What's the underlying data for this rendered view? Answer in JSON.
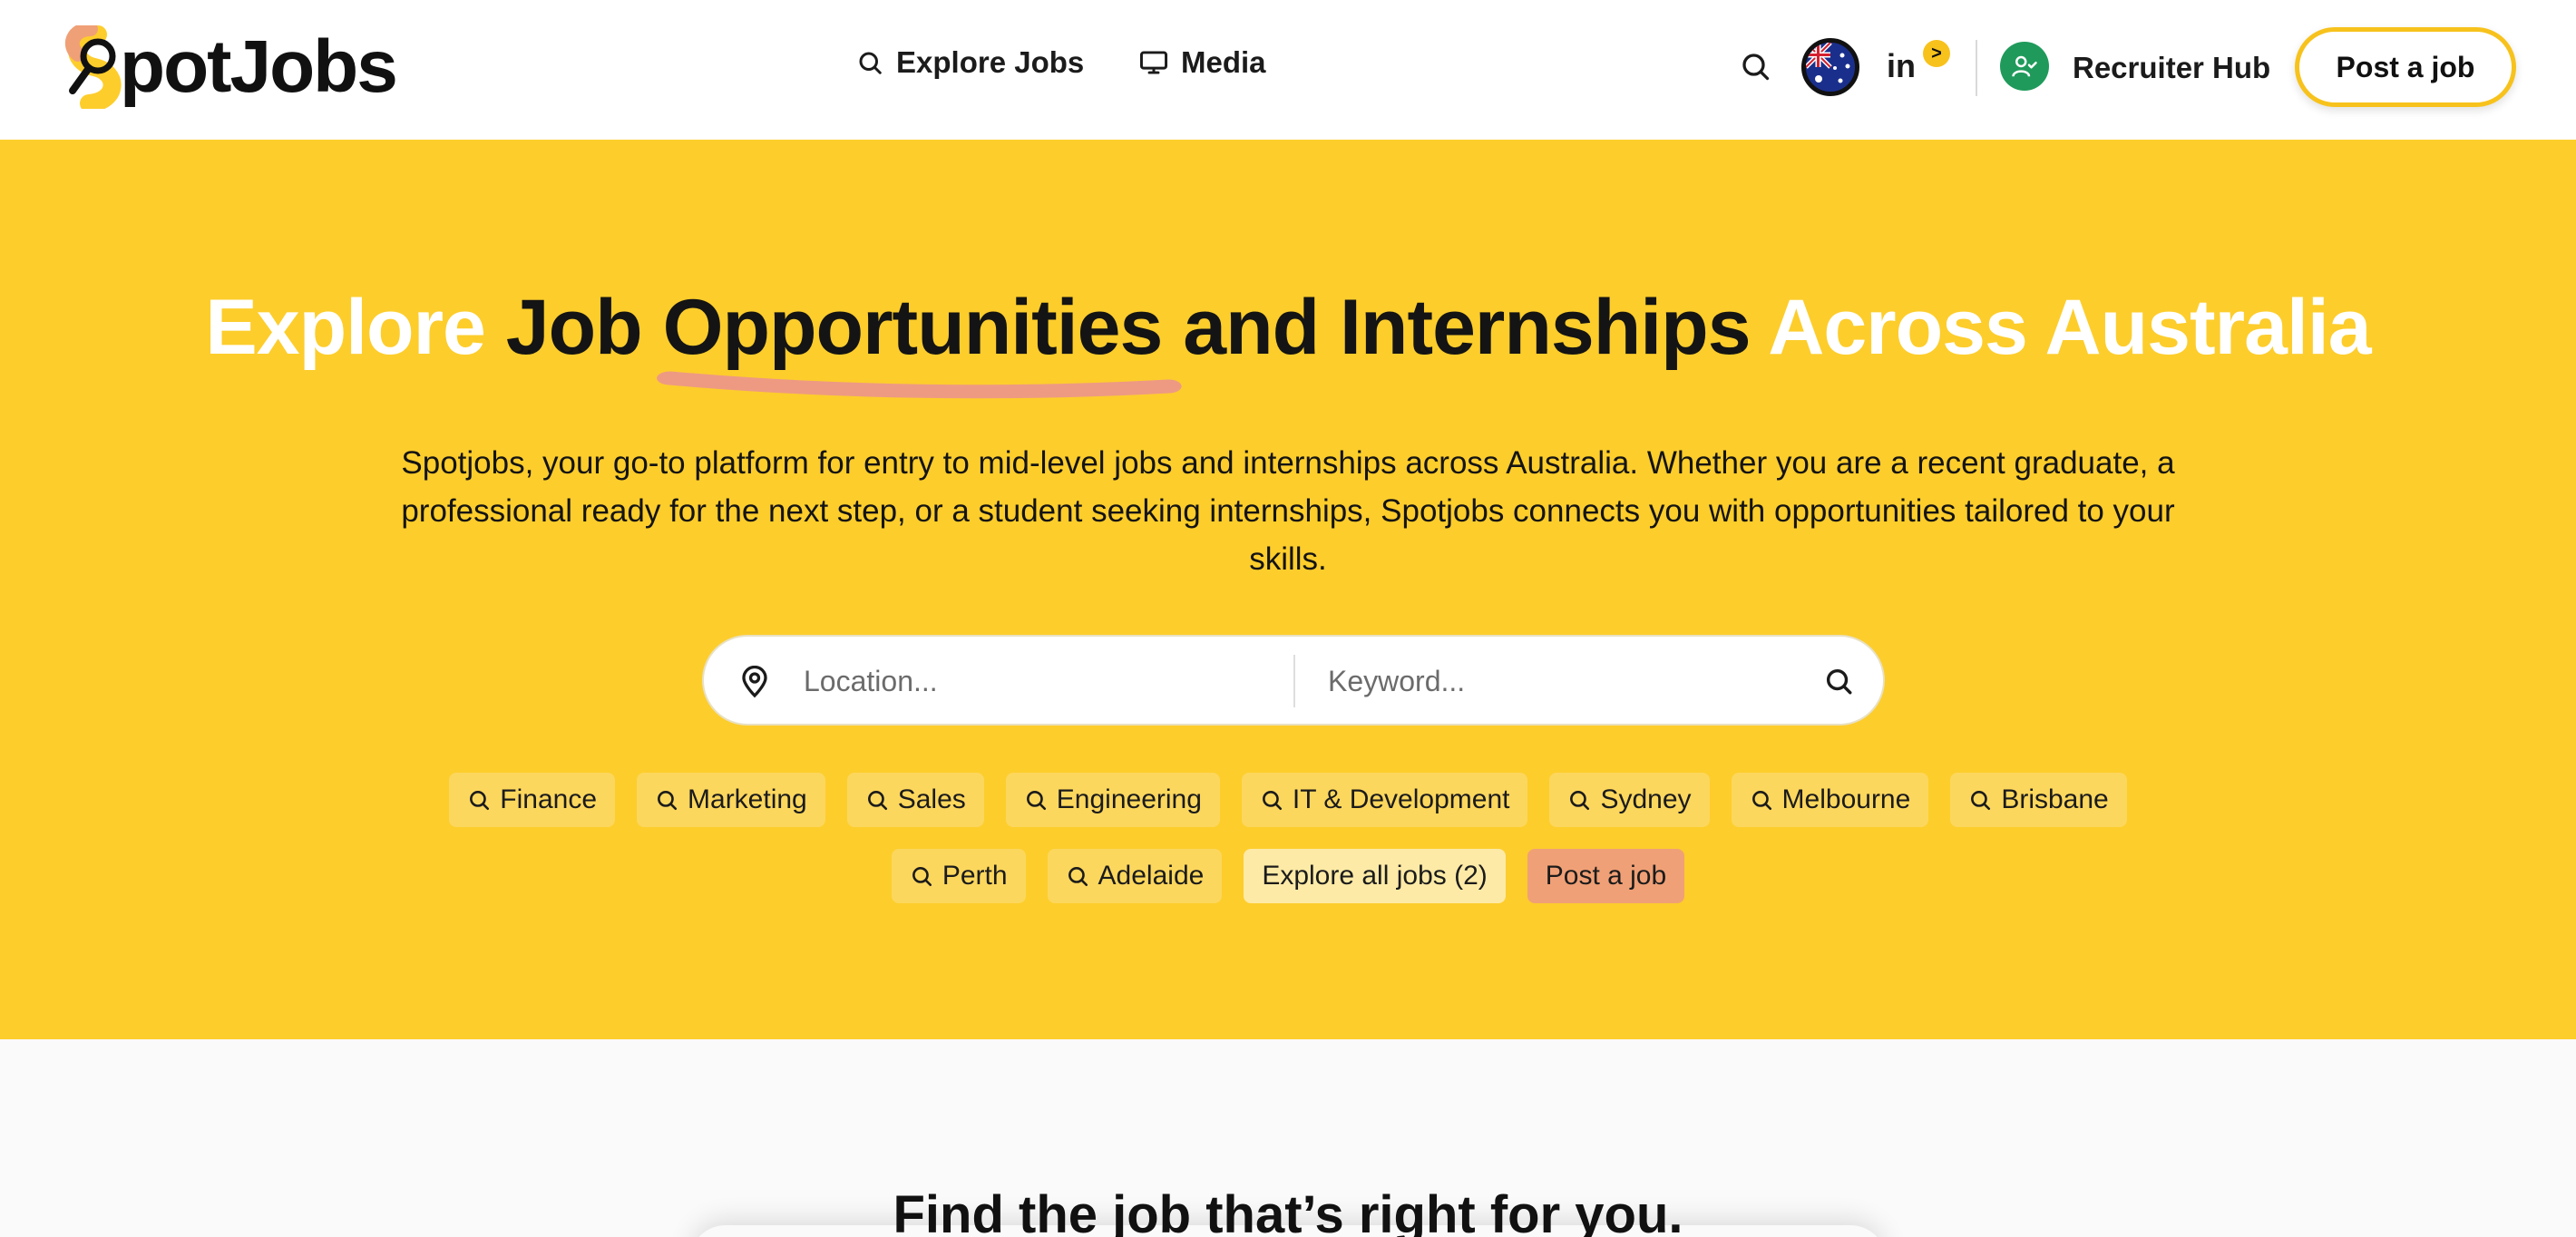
{
  "header": {
    "logo_text": "potJobs",
    "nav": {
      "explore_label": "Explore Jobs",
      "media_label": "Media"
    },
    "linkedin_label": "in",
    "badge_label": ">",
    "recruiter_label": "Recruiter Hub",
    "post_job_label": "Post a job",
    "icons": [
      "search-icon",
      "australia-flag-icon",
      "linkedin-icon",
      "user-check-icon"
    ]
  },
  "hero": {
    "headline": {
      "part1": "Explore",
      "part2": "Job",
      "part3": "Opportunities",
      "part4": "and Internships",
      "part5": "Across Australia"
    },
    "description": "Spotjobs, your go-to platform for entry to mid-level jobs and internships across Australia. Whether you are a recent graduate, a professional ready for the next step, or a student seeking internships, Spotjobs connects you with opportunities tailored to your skills.",
    "search": {
      "location_placeholder": "Location...",
      "keyword_placeholder": "Keyword..."
    },
    "tags_row1": [
      "Finance",
      "Marketing",
      "Sales",
      "Engineering",
      "IT & Development",
      "Sydney",
      "Melbourne",
      "Brisbane"
    ],
    "tags_row2": [
      "Perth",
      "Adelaide"
    ],
    "explore_all_label": "Explore all jobs (2)",
    "post_job_tag_label": "Post a job"
  },
  "lower": {
    "title": "Find the job that’s right for you."
  },
  "colors": {
    "brand_yellow": "#fdcd2c",
    "tag_yellow": "#fcd75d",
    "explore_tag": "#fdeaa6",
    "post_tag": "#f0a076",
    "underline": "#ee9a83",
    "recruiter_green": "#1f9a5b"
  }
}
